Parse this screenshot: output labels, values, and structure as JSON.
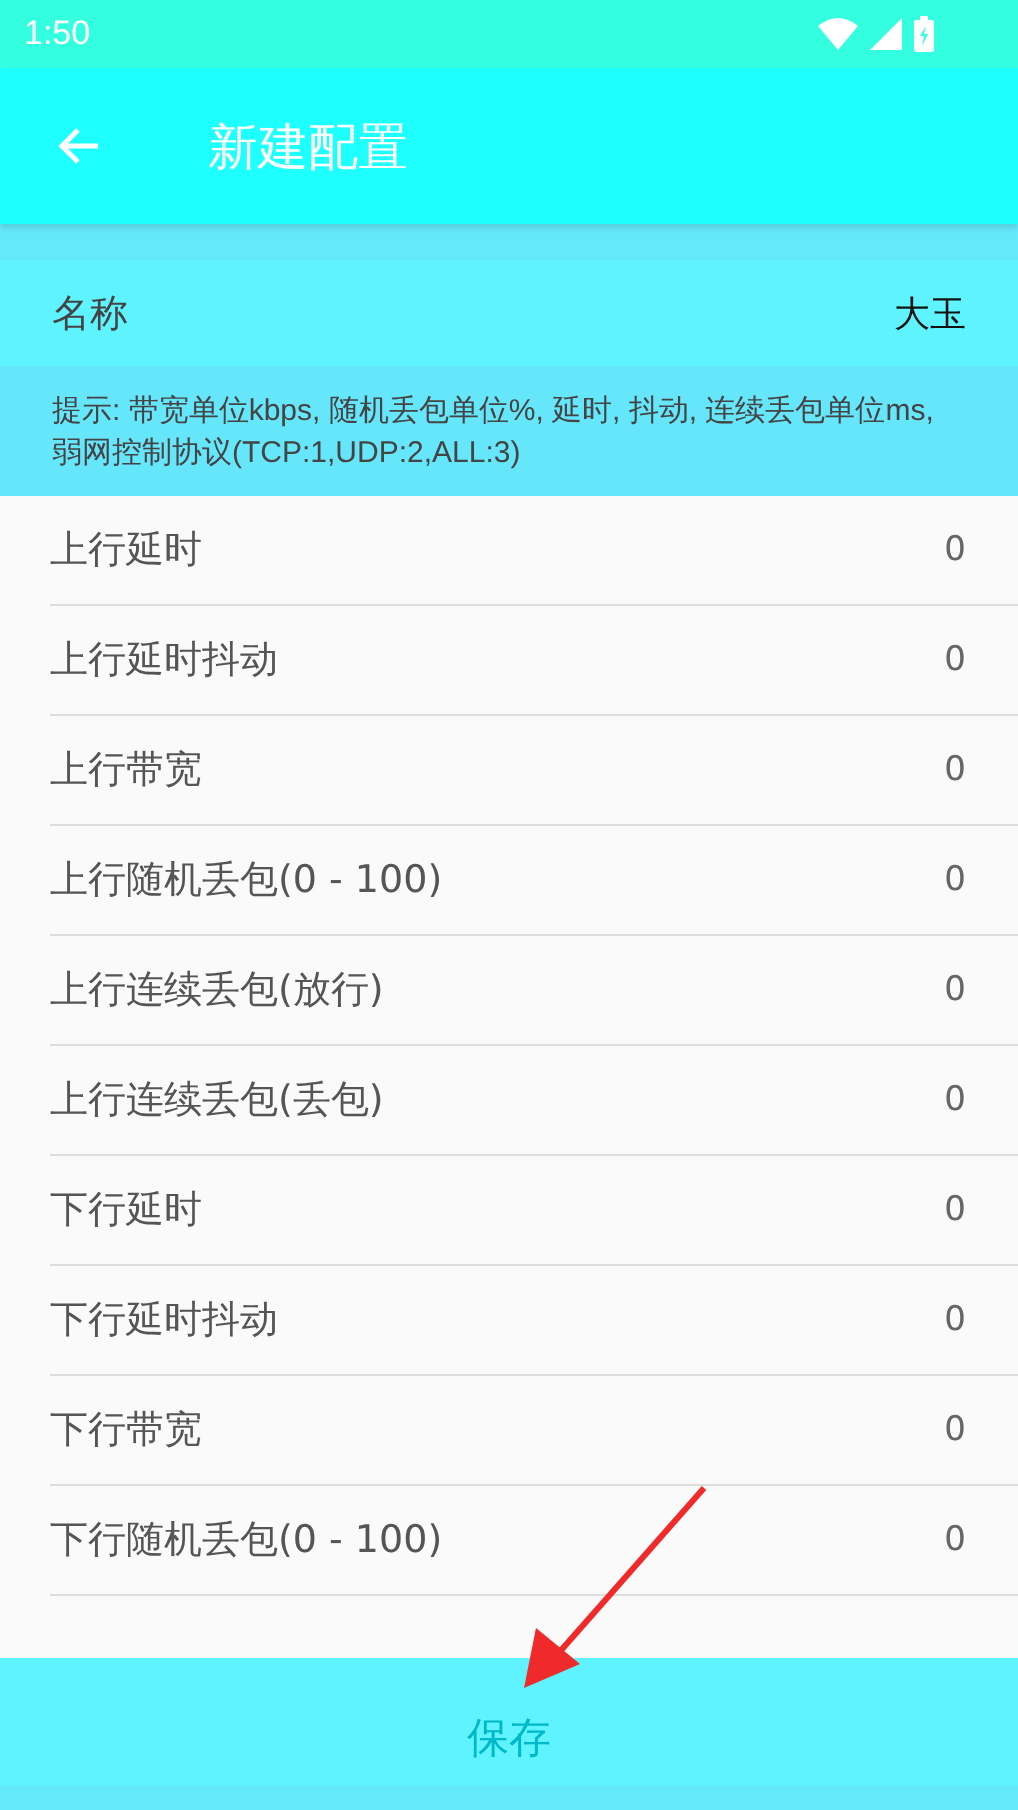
{
  "status_bar": {
    "time": "1:50"
  },
  "toolbar": {
    "title": "新建配置"
  },
  "name_field": {
    "label": "名称",
    "value": "大玉"
  },
  "hint": "提示: 带宽单位kbps, 随机丢包单位%, 延时, 抖动, 连续丢包单位ms, 弱网控制协议(TCP:1,UDP:2,ALL:3)",
  "settings": [
    {
      "label": "上行延时",
      "value": "0"
    },
    {
      "label": "上行延时抖动",
      "value": "0"
    },
    {
      "label": "上行带宽",
      "value": "0"
    },
    {
      "label": "上行随机丢包(0 - 100)",
      "value": "0"
    },
    {
      "label": "上行连续丢包(放行)",
      "value": "0"
    },
    {
      "label": "上行连续丢包(丢包)",
      "value": "0"
    },
    {
      "label": "下行延时",
      "value": "0"
    },
    {
      "label": "下行延时抖动",
      "value": "0"
    },
    {
      "label": "下行带宽",
      "value": "0"
    },
    {
      "label": "下行随机丢包(0 - 100)",
      "value": "0"
    }
  ],
  "save_button": "保存"
}
